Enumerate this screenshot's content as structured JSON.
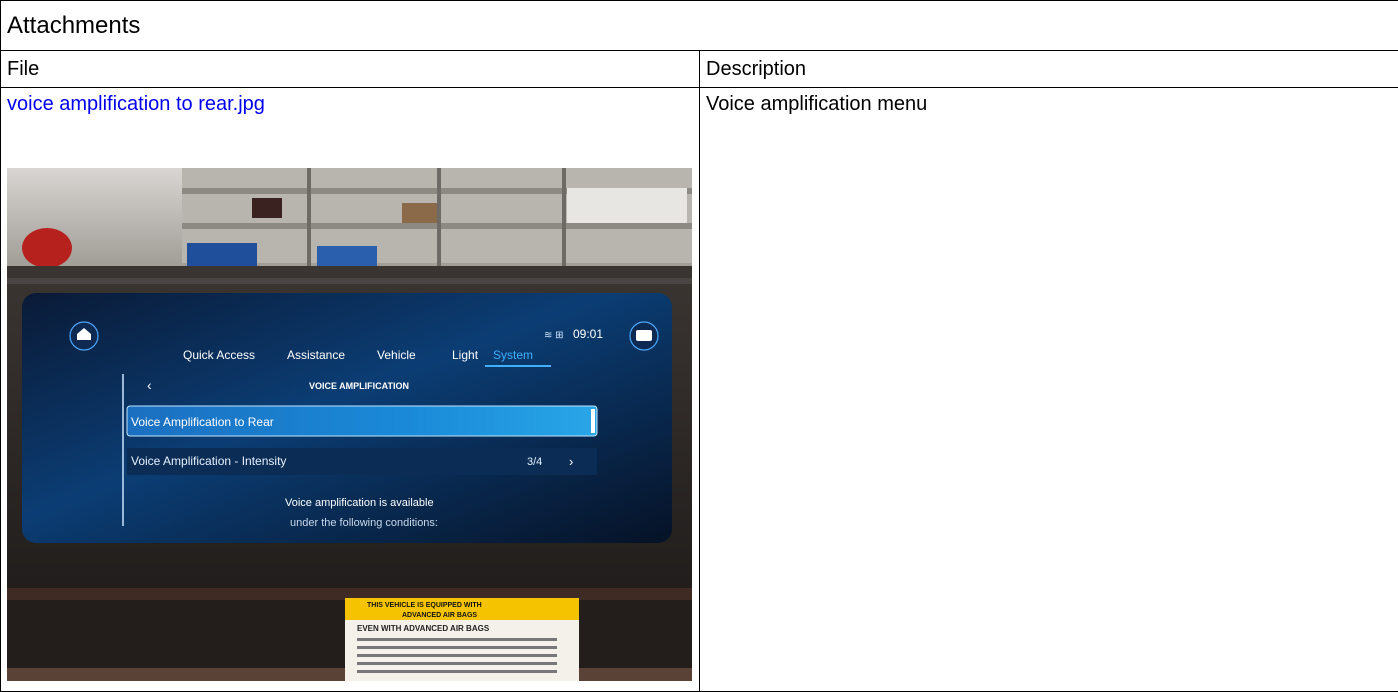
{
  "title": "Attachments",
  "columns": {
    "file": "File",
    "description": "Description"
  },
  "rows": [
    {
      "file_name": "voice amplification to rear.jpg",
      "description": "Voice amplification menu",
      "photo": {
        "status_time": "09:01",
        "tabs": [
          "Quick Access",
          "Assistance",
          "Vehicle",
          "Light",
          "System"
        ],
        "active_tab": "System",
        "header": "VOICE AMPLIFICATION",
        "item1": "Voice Amplification to Rear",
        "item2": "Voice Amplification - Intensity",
        "item2_value": "3/4",
        "info_line1": "Voice amplification is available",
        "info_line2": "under the following conditions:",
        "sticker_line1": "THIS VEHICLE IS EQUIPPED WITH",
        "sticker_line2": "ADVANCED AIR BAGS",
        "sticker_line3": "EVEN WITH ADVANCED AIR BAGS"
      }
    }
  ]
}
